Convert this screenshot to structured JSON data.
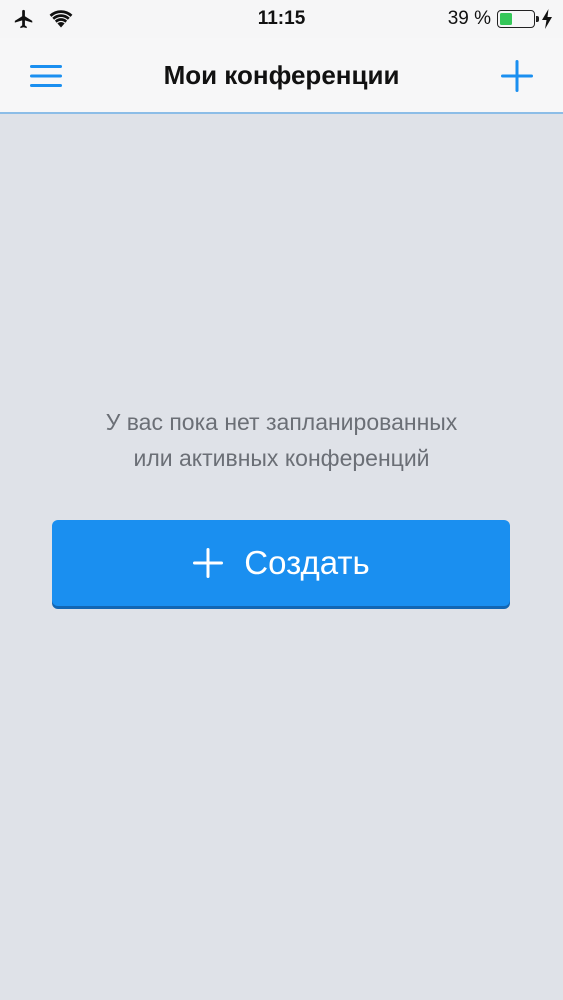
{
  "status_bar": {
    "time": "11:15",
    "battery_percent_label": "39 %",
    "battery_level": 0.39,
    "icons": [
      "airplane-icon",
      "wifi-icon",
      "battery-icon",
      "charging-bolt-icon"
    ]
  },
  "nav_bar": {
    "title": "Мои конференции",
    "left_icon": "menu-icon",
    "right_icon": "plus-icon"
  },
  "empty_state": {
    "line1": "У вас пока нет запланированных",
    "line2": "или активных конференций"
  },
  "create_button": {
    "label": "Создать",
    "icon": "plus-icon"
  },
  "colors": {
    "accent": "#1a8ff0",
    "background": "#dfe2e8",
    "nav_background": "#f7f7f8",
    "text_muted": "#6b6f76",
    "battery": "#35c759"
  }
}
